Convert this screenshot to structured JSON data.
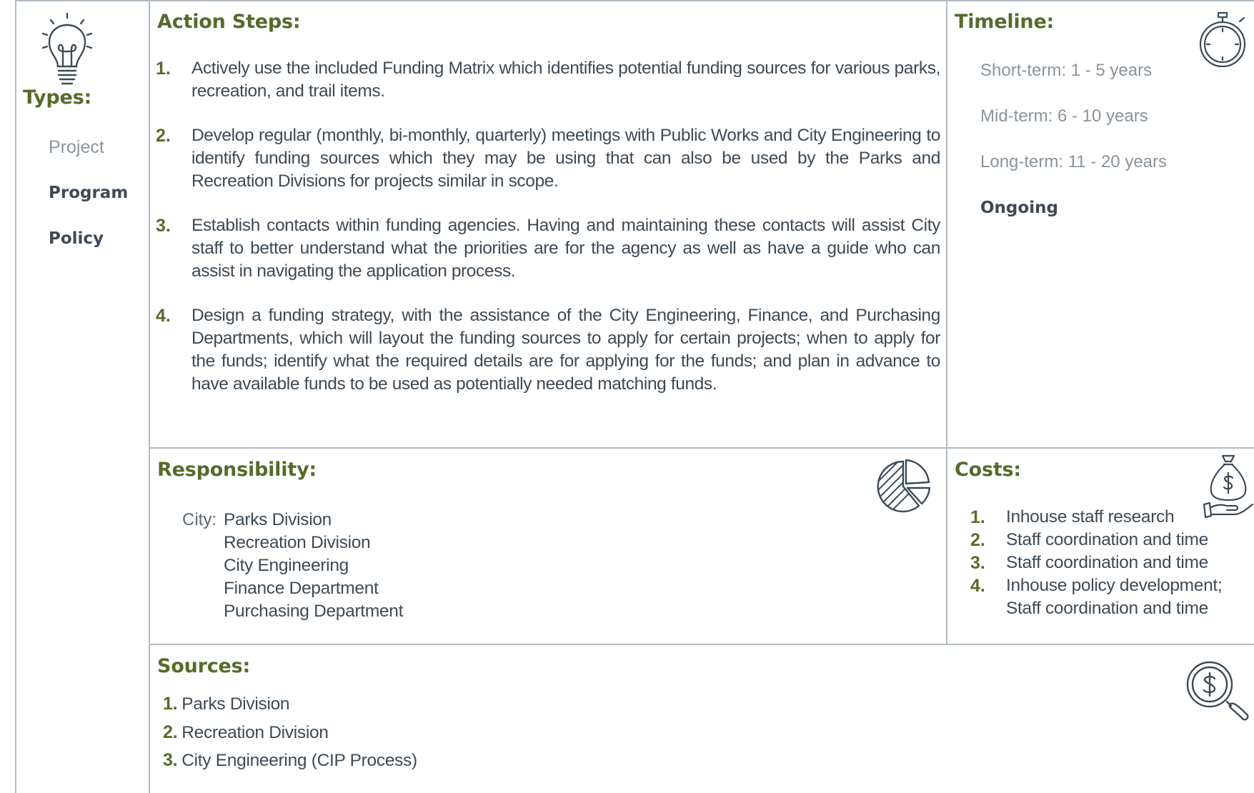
{
  "types": {
    "heading": "Types:",
    "items": [
      "Project",
      "Program",
      "Policy"
    ]
  },
  "action_steps": {
    "heading": "Action Steps:",
    "items": [
      {
        "num": "1.",
        "text": "Actively use the included Funding Matrix which identifies potential funding sources for various parks, recreation, and trail items."
      },
      {
        "num": "2.",
        "text": "Develop regular (monthly, bi-monthly, quarterly) meetings with Public Works and City Engineering to identify funding sources which they may be using that can also be used by the Parks and Recreation Divisions for projects similar in scope."
      },
      {
        "num": "3.",
        "text": "Establish contacts within funding agencies. Having and maintaining these contacts will assist City staff to better understand what the priorities are for the agency as well as have a guide who can assist in navigating the application process."
      },
      {
        "num": "4.",
        "text": "Design a funding strategy, with the assistance of the City Engineering, Finance, and Purchasing Departments, which will layout the funding sources to apply for certain projects; when to apply for the funds; identify what the required details are for applying for the funds; and plan in advance to have available funds to be used as potentially needed matching funds."
      }
    ]
  },
  "timeline": {
    "heading": "Timeline:",
    "items": [
      "Short-term: 1 - 5 years",
      "Mid-term:  6 - 10 years",
      "Long-term:  11 - 20 years",
      "Ongoing"
    ]
  },
  "responsibility": {
    "heading": "Responsibility:",
    "label": "City:",
    "items": [
      "Parks Division",
      "Recreation Division",
      "City Engineering",
      "Finance Department",
      "Purchasing Department"
    ]
  },
  "costs": {
    "heading": "Costs:",
    "items": [
      {
        "num": "1.",
        "text": "Inhouse staff research"
      },
      {
        "num": "2.",
        "text": "Staff coordination and time"
      },
      {
        "num": "3.",
        "text": "Staff coordination and time"
      },
      {
        "num": "4.",
        "text": "Inhouse policy development;"
      },
      {
        "num": "",
        "text": "Staff coordination and time"
      }
    ]
  },
  "sources": {
    "heading": "Sources:",
    "items": [
      {
        "num": "1.",
        "text": "Parks Division"
      },
      {
        "num": "2.",
        "text": "Recreation Division"
      },
      {
        "num": "3.",
        "text": "City Engineering (CIP Process)"
      }
    ]
  },
  "icons": {
    "types": "lightbulb-icon",
    "timeline": "stopwatch-icon",
    "responsibility": "pie-chart-icon",
    "costs": "money-bag-hand-icon",
    "sources": "dollar-magnifier-icon"
  },
  "colors": {
    "heading": "#586a2b",
    "text": "#3c4a57",
    "muted": "#8a949c",
    "rule": "#b2bcc3"
  }
}
